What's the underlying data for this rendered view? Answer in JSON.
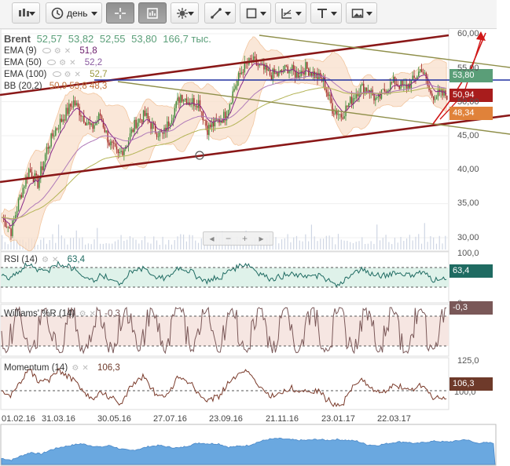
{
  "toolbar": {
    "period_label": "день",
    "buttons": [
      "candles-icon",
      "clock-icon",
      "crosshair-icon",
      "window-icon",
      "indicators-icon",
      "line-tool-icon",
      "shape-icon",
      "fib-icon",
      "text-tool-icon",
      "image-icon"
    ]
  },
  "legend": {
    "symbol": "Brent",
    "open": "52,57",
    "high": "53,82",
    "low": "52,55",
    "close": "53,80",
    "volume": "166,7 тыс.",
    "ema9_label": "EMA (9)",
    "ema9_value": "51,8",
    "ema50_label": "EMA (50)",
    "ema50_value": "52,2",
    "ema100_label": "EMA (100)",
    "ema100_value": "52,7",
    "bb_label": "BB (20,2)",
    "bb_values": "50,9  53,8  48,3"
  },
  "price_tags": {
    "close": "53,80",
    "mid": "50,94",
    "low": "48,34"
  },
  "rsi": {
    "label": "RSI (14)",
    "value": "63,4"
  },
  "williams": {
    "label": "Williams' %R (14)",
    "value": "-0,3"
  },
  "momentum": {
    "label": "Momentum (14)",
    "value": "106,3"
  },
  "colors": {
    "close_tag": "#5a9e78",
    "mid_tag": "#a81c1c",
    "low_tag": "#e0823a",
    "rsi_tag": "#1f6b62",
    "will_tag": "#7a5858",
    "mom_tag": "#6e3a2a",
    "channel": "#8a1818",
    "hline": "#2030a0"
  },
  "chart_data": {
    "type": "candlestick",
    "title": "Brent",
    "x_dates": [
      "01.02.16",
      "31.03.16",
      "30.05.16",
      "27.07.16",
      "23.09.16",
      "21.11.16",
      "23.01.17",
      "22.03.17"
    ],
    "price_ticks": [
      "60,00",
      "55,00",
      "50,00",
      "45,00",
      "40,00",
      "35,00",
      "30,00"
    ],
    "ylim": [
      28,
      60
    ],
    "close_path": [
      [
        0,
        33
      ],
      [
        6,
        31
      ],
      [
        12,
        36
      ],
      [
        18,
        40
      ],
      [
        24,
        38
      ],
      [
        30,
        43
      ],
      [
        36,
        46
      ],
      [
        42,
        48
      ],
      [
        48,
        50
      ],
      [
        54,
        48
      ],
      [
        60,
        46
      ],
      [
        66,
        48
      ],
      [
        72,
        44
      ],
      [
        78,
        42
      ],
      [
        84,
        44
      ],
      [
        90,
        47
      ],
      [
        96,
        48
      ],
      [
        102,
        46
      ],
      [
        108,
        45
      ],
      [
        114,
        48
      ],
      [
        120,
        51
      ],
      [
        126,
        50
      ],
      [
        132,
        50
      ],
      [
        138,
        46
      ],
      [
        144,
        47
      ],
      [
        150,
        48
      ],
      [
        156,
        52
      ],
      [
        162,
        55
      ],
      [
        168,
        56
      ],
      [
        174,
        55
      ],
      [
        180,
        54
      ],
      [
        186,
        54
      ],
      [
        192,
        55
      ],
      [
        198,
        54
      ],
      [
        204,
        55
      ],
      [
        210,
        54
      ],
      [
        216,
        53
      ],
      [
        222,
        49
      ],
      [
        228,
        48
      ],
      [
        234,
        50
      ],
      [
        240,
        52
      ],
      [
        246,
        52
      ],
      [
        252,
        50
      ],
      [
        258,
        52
      ],
      [
        264,
        53
      ],
      [
        270,
        52
      ],
      [
        276,
        53
      ],
      [
        282,
        55
      ],
      [
        288,
        51
      ]
    ],
    "rsi": {
      "ticks": [
        "100,0"
      ],
      "value": 63.4
    },
    "williams": {
      "ticks": [
        "0"
      ],
      "value": -0.3
    },
    "momentum": {
      "ticks": [
        "125,0",
        "100,0"
      ],
      "value": 106.3
    }
  }
}
